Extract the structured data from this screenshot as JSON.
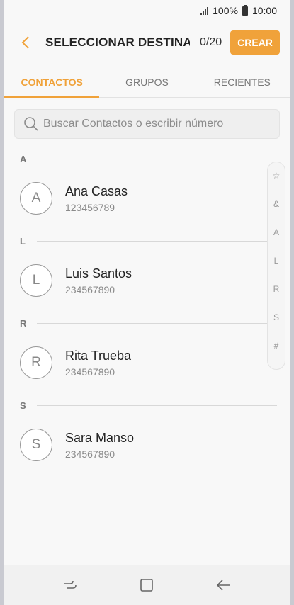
{
  "status_bar": {
    "battery": "100%",
    "time": "10:00"
  },
  "header": {
    "title": "SELECCIONAR DESTINA...",
    "counter": "0/20",
    "create_label": "CREAR"
  },
  "tabs": [
    {
      "label": "CONTACTOS",
      "active": true
    },
    {
      "label": "GRUPOS",
      "active": false
    },
    {
      "label": "RECIENTES",
      "active": false
    }
  ],
  "search": {
    "placeholder": "Buscar Contactos o escribir número",
    "value": ""
  },
  "sections": [
    {
      "letter": "A",
      "contact": {
        "initial": "A",
        "name": "Ana Casas",
        "number": "123456789"
      }
    },
    {
      "letter": "L",
      "contact": {
        "initial": "L",
        "name": "Luis Santos",
        "number": "234567890"
      }
    },
    {
      "letter": "R",
      "contact": {
        "initial": "R",
        "name": "Rita Trueba",
        "number": "234567890"
      }
    },
    {
      "letter": "S",
      "contact": {
        "initial": "S",
        "name": "Sara Manso",
        "number": "234567890"
      }
    }
  ],
  "index_bar": [
    "☆",
    "&",
    "A",
    "L",
    "R",
    "S",
    "#"
  ],
  "colors": {
    "accent": "#f0a23a"
  }
}
